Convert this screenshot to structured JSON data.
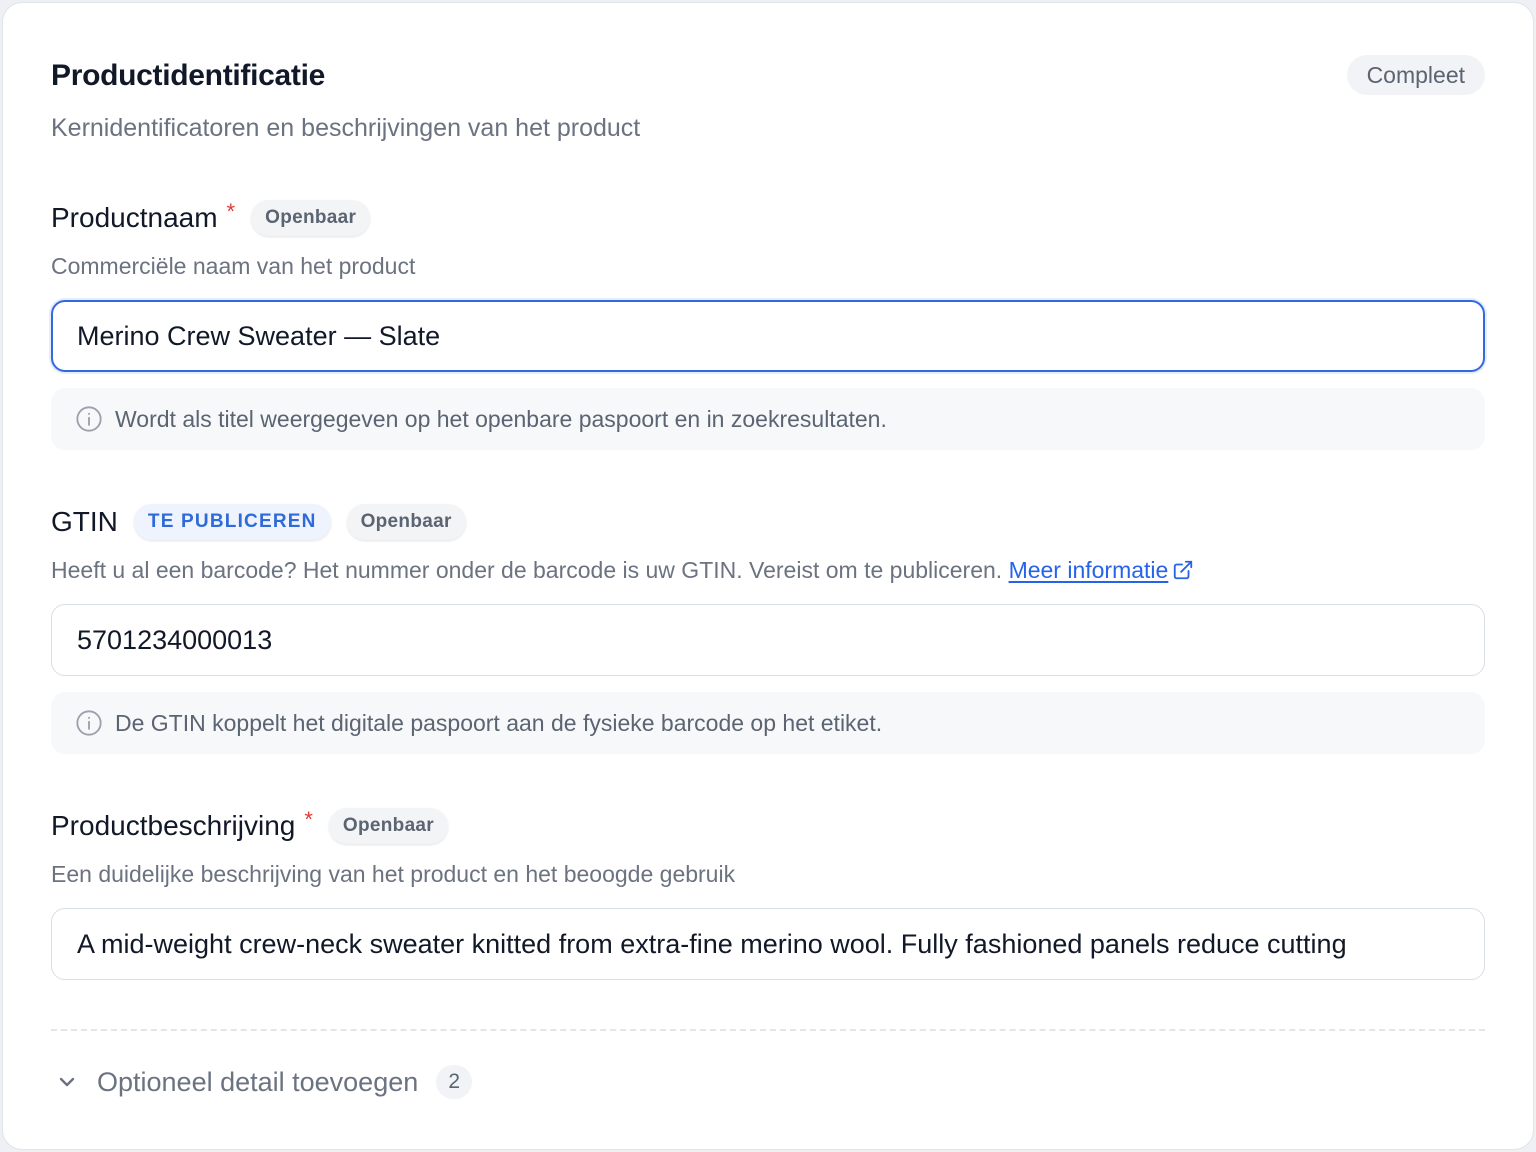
{
  "section": {
    "title": "Productidentificatie",
    "subtitle": "Kernidentificatoren en beschrijvingen van het product",
    "status": "Compleet"
  },
  "fields": {
    "name": {
      "label": "Productnaam",
      "required_mark": "*",
      "visibility": "Openbaar",
      "help": "Commerciële naam van het product",
      "value": "Merino Crew Sweater — Slate",
      "note": "Wordt als titel weergegeven op het openbare paspoort en in zoekresultaten."
    },
    "gtin": {
      "label": "GTIN",
      "publish_tag": "TE PUBLICEREN",
      "visibility": "Openbaar",
      "help": "Heeft u al een barcode? Het nummer onder de barcode is uw GTIN. Vereist om te publiceren.",
      "link": "Meer informatie",
      "value": "5701234000013",
      "note": "De GTIN koppelt het digitale paspoort aan de fysieke barcode op het etiket."
    },
    "description": {
      "label": "Productbeschrijving",
      "required_mark": "*",
      "visibility": "Openbaar",
      "help": "Een duidelijke beschrijving van het product en het beoogde gebruik",
      "value": "A mid-weight crew-neck sweater knitted from extra-fine merino wool. Fully fashioned panels reduce cutting"
    }
  },
  "optional": {
    "label": "Optioneel detail toevoegen",
    "count": "2"
  },
  "icons": {
    "info": "info-circle-icon",
    "external": "external-link-icon",
    "chevron": "chevron-down-icon"
  },
  "colors": {
    "accent": "#2563eb",
    "required": "#dc3d3d",
    "muted_text": "#6b7280"
  }
}
